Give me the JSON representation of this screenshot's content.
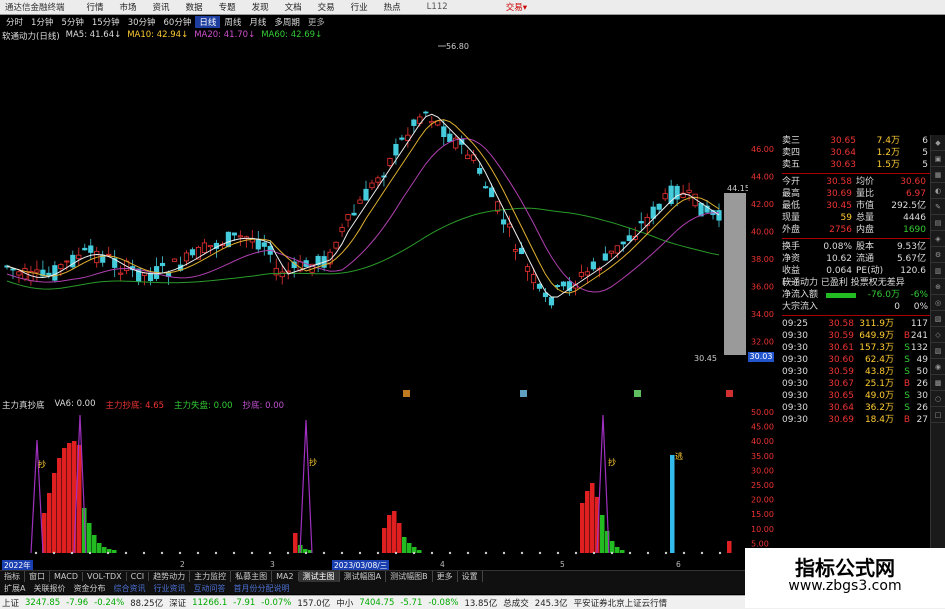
{
  "menubar": {
    "title": "通达信金融终端",
    "items": [
      "行情",
      "市场",
      "资讯",
      "数据",
      "专题",
      "发现",
      "文档",
      "交易",
      "行业",
      "热点"
    ],
    "version": "L112",
    "trade": "交易▾"
  },
  "periodbar": {
    "items": [
      "分时",
      "1分钟",
      "5分钟",
      "15分钟",
      "30分钟",
      "60分钟",
      "日线",
      "周线",
      "月线",
      "多周期",
      "更多"
    ],
    "active_index": 6
  },
  "ma_line": {
    "name": "软通动力(日线)",
    "ma5": "MA5: 41.64↓",
    "ma10": "MA10: 42.94↓",
    "ma20": "MA20: 41.70↓",
    "ma60": "MA60: 42.69↓"
  },
  "price_chart": {
    "high_label": "56.80",
    "right_label": "44.15",
    "low_label": "30.45",
    "last_label": "30.03",
    "scale": [
      "46.00",
      "44.00",
      "42.00",
      "40.00",
      "38.00",
      "36.00",
      "34.00",
      "32.00"
    ]
  },
  "indicator": {
    "header_name": "主力真抄底",
    "header_va": "VA6: 0.00",
    "zhuli_shouchou": "主力抄底: 4.65",
    "zhuli_shipan": "主力失盘: 0.00",
    "chaodi": "抄底: 0.00",
    "scale": [
      "50.00",
      "45.00",
      "40.00",
      "35.00",
      "30.00",
      "25.00",
      "20.00",
      "15.00",
      "10.00",
      "5.00"
    ],
    "labels": [
      "抄",
      "抄",
      "抄",
      "逃"
    ]
  },
  "dates": {
    "d1": "2022年",
    "d2": "2",
    "d3": "3",
    "d4": "2023/03/08/三",
    "d5": "4",
    "d6": "5",
    "d7": "6"
  },
  "quote": {
    "asks": [
      {
        "l": "卖三",
        "p": "30.65",
        "v": "7.4万",
        "n": "6"
      },
      {
        "l": "卖四",
        "p": "30.64",
        "v": "1.2万",
        "n": "5"
      },
      {
        "l": "卖五",
        "p": "30.63",
        "v": "1.5万",
        "n": "5"
      }
    ],
    "stats": [
      {
        "k": "今开",
        "v": "30.58",
        "k2": "均价",
        "v2": "30.60"
      },
      {
        "k": "最高",
        "v": "30.69",
        "k2": "量比",
        "v2": "6.97"
      },
      {
        "k": "最低",
        "v": "30.45",
        "k2": "市值",
        "v2": "292.5亿"
      },
      {
        "k": "现量",
        "v": "59",
        "k2": "总量",
        "v2": "4446"
      },
      {
        "k": "外盘",
        "v": "2756",
        "k2": "内盘",
        "v2": "1690"
      }
    ],
    "stats2": [
      {
        "k": "换手",
        "v": "0.08%",
        "k2": "股本",
        "v2": "9.53亿"
      },
      {
        "k": "净资",
        "v": "10.62",
        "k2": "流通",
        "v2": "5.67亿"
      },
      {
        "k": "收益(一)",
        "v": "0.064",
        "k2": "PE(动)",
        "v2": "120.6"
      }
    ],
    "extra": [
      {
        "text": "软通动力  已盈利  投票权无差异"
      },
      {
        "text": "净流入额",
        "val": "-76.0万",
        "val2": "-6%"
      },
      {
        "text": "大宗流入",
        "val": "0",
        "val2": "0%"
      }
    ],
    "ticks": [
      {
        "t": "09:25",
        "p": "30.58",
        "v": "311.9万",
        "bs": "",
        "n": "117"
      },
      {
        "t": "09:30",
        "p": "30.59",
        "v": "649.9万",
        "bs": "B",
        "n": "241"
      },
      {
        "t": "09:30",
        "p": "30.61",
        "v": "157.3万",
        "bs": "S",
        "n": "132"
      },
      {
        "t": "09:30",
        "p": "30.60",
        "v": "62.4万",
        "bs": "S",
        "n": "49"
      },
      {
        "t": "09:30",
        "p": "30.59",
        "v": "43.8万",
        "bs": "S",
        "n": "50"
      },
      {
        "t": "09:30",
        "p": "30.67",
        "v": "25.1万",
        "bs": "B",
        "n": "26"
      },
      {
        "t": "09:30",
        "p": "30.65",
        "v": "49.0万",
        "bs": "S",
        "n": "30"
      },
      {
        "t": "09:30",
        "p": "30.64",
        "v": "36.2万",
        "bs": "S",
        "n": "26"
      },
      {
        "t": "09:30",
        "p": "30.69",
        "v": "18.4万",
        "bs": "B",
        "n": "27"
      }
    ]
  },
  "tabs": [
    "指标",
    "窗口",
    "MACD",
    "VOL-TDX",
    "CCI",
    "趋势动力",
    "主力监控",
    "私募主图",
    "MA2",
    "测试主图",
    "测试幅图A",
    "测试幅图B",
    "更多",
    "设置"
  ],
  "tabs_active": 9,
  "subtabs": [
    "扩展A",
    "关联报价",
    "资金分布",
    "综合资讯",
    "行业资讯",
    "互动问答",
    "首月份分配说明"
  ],
  "statusbar": {
    "sh_label": "上证",
    "sh_val": "3247.85",
    "sh_chg": "-7.96",
    "sh_pct": "-0.24%",
    "sh_amt": "88.25亿",
    "sz_label": "深证",
    "sz_val": "11266.1",
    "sz_chg": "-7.91",
    "sz_pct": "-0.07%",
    "sz_amt": "157.0亿",
    "zx_label": "中小",
    "zx_val": "7404.75",
    "zx_chg": "-5.71",
    "zx_pct": "-0.08%",
    "zx_amt": "13.85亿",
    "total_label": "总成交",
    "total_val": "245.3亿",
    "broker": "平安证券北京上证云行情"
  },
  "watermark": {
    "big": "指标公式网",
    "small": "www.zbgs3.com"
  },
  "colors": {
    "up": "#e33333",
    "down": "#33dddd",
    "ma5": "#ffffff",
    "ma10": "#ffcc33",
    "ma20": "#cc33cc",
    "ma60": "#33aa33",
    "bar_red": "#e02020",
    "bar_green": "#22bb22",
    "spike": "#a030c0",
    "escape": "#33bbee"
  }
}
